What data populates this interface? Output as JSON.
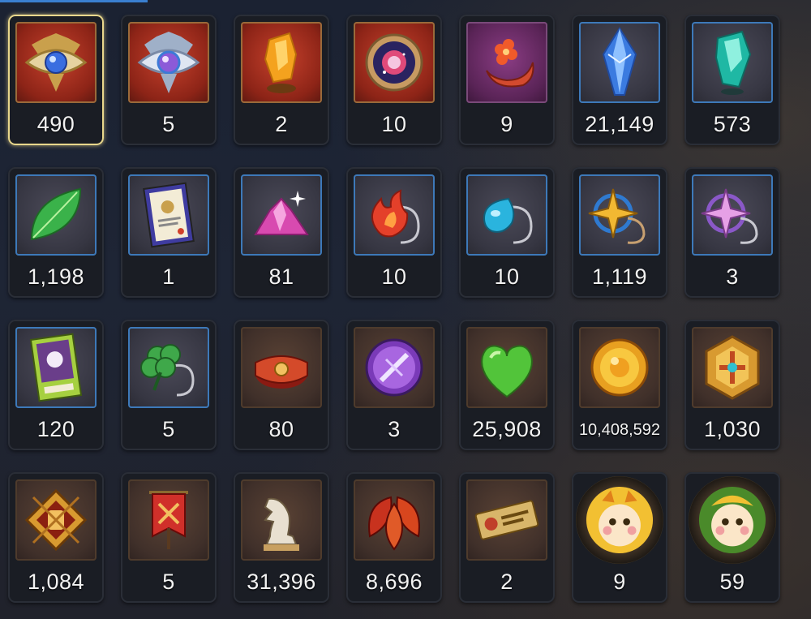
{
  "colors": {
    "accent_selected": "#e8d78c",
    "text": "#f2f2f2"
  },
  "items": [
    {
      "icon": "golden-eye-crest-icon",
      "bg": "red",
      "count": "490",
      "selected": true
    },
    {
      "icon": "silver-eye-crest-icon",
      "bg": "red",
      "count": "5"
    },
    {
      "icon": "amber-crystal-shard-icon",
      "bg": "red",
      "count": "2"
    },
    {
      "icon": "cosmic-disc-icon",
      "bg": "red",
      "count": "10"
    },
    {
      "icon": "crescent-flower-charm-icon",
      "bg": "purple",
      "count": "9"
    },
    {
      "icon": "blue-crystal-icon",
      "bg": "blue",
      "count": "21,149"
    },
    {
      "icon": "teal-crystal-shard-icon",
      "bg": "blue",
      "count": "573"
    },
    {
      "icon": "green-leaf-icon",
      "bg": "blue",
      "count": "1,198"
    },
    {
      "icon": "certificate-card-icon",
      "bg": "blue",
      "count": "1"
    },
    {
      "icon": "pink-crystal-cluster-icon",
      "bg": "blue",
      "count": "81"
    },
    {
      "icon": "fire-pendant-icon",
      "bg": "blue",
      "count": "10"
    },
    {
      "icon": "water-drop-pendant-icon",
      "bg": "blue",
      "count": "10"
    },
    {
      "icon": "gold-star-pendant-icon",
      "bg": "blue",
      "count": "1,119"
    },
    {
      "icon": "pink-star-pendant-icon",
      "bg": "blue",
      "count": "3"
    },
    {
      "icon": "green-ticket-card-icon",
      "bg": "blue",
      "count": "120"
    },
    {
      "icon": "clover-pendant-icon",
      "bg": "blue",
      "count": "5"
    },
    {
      "icon": "red-bracelet-icon",
      "bg": "brown",
      "count": "80"
    },
    {
      "icon": "purple-sword-badge-icon",
      "bg": "brown",
      "count": "3"
    },
    {
      "icon": "green-heart-icon",
      "bg": "brown",
      "count": "25,908"
    },
    {
      "icon": "gold-sun-coin-icon",
      "bg": "brown",
      "count": "10,408,592",
      "small": true
    },
    {
      "icon": "gold-hexagon-emblem-icon",
      "bg": "brown",
      "count": "1,030"
    },
    {
      "icon": "fist-diamond-emblem-icon",
      "bg": "brown",
      "count": "1,084"
    },
    {
      "icon": "red-banner-swords-icon",
      "bg": "brown",
      "count": "5"
    },
    {
      "icon": "knight-chess-piece-icon",
      "bg": "brown",
      "count": "31,396"
    },
    {
      "icon": "red-leaves-icon",
      "bg": "brown",
      "count": "8,696"
    },
    {
      "icon": "gold-ticket-icon",
      "bg": "brown",
      "count": "2"
    },
    {
      "icon": "yellow-cookie-portrait-icon",
      "bg": "round",
      "count": "9"
    },
    {
      "icon": "green-cookie-portrait-icon",
      "bg": "round",
      "count": "59"
    }
  ]
}
